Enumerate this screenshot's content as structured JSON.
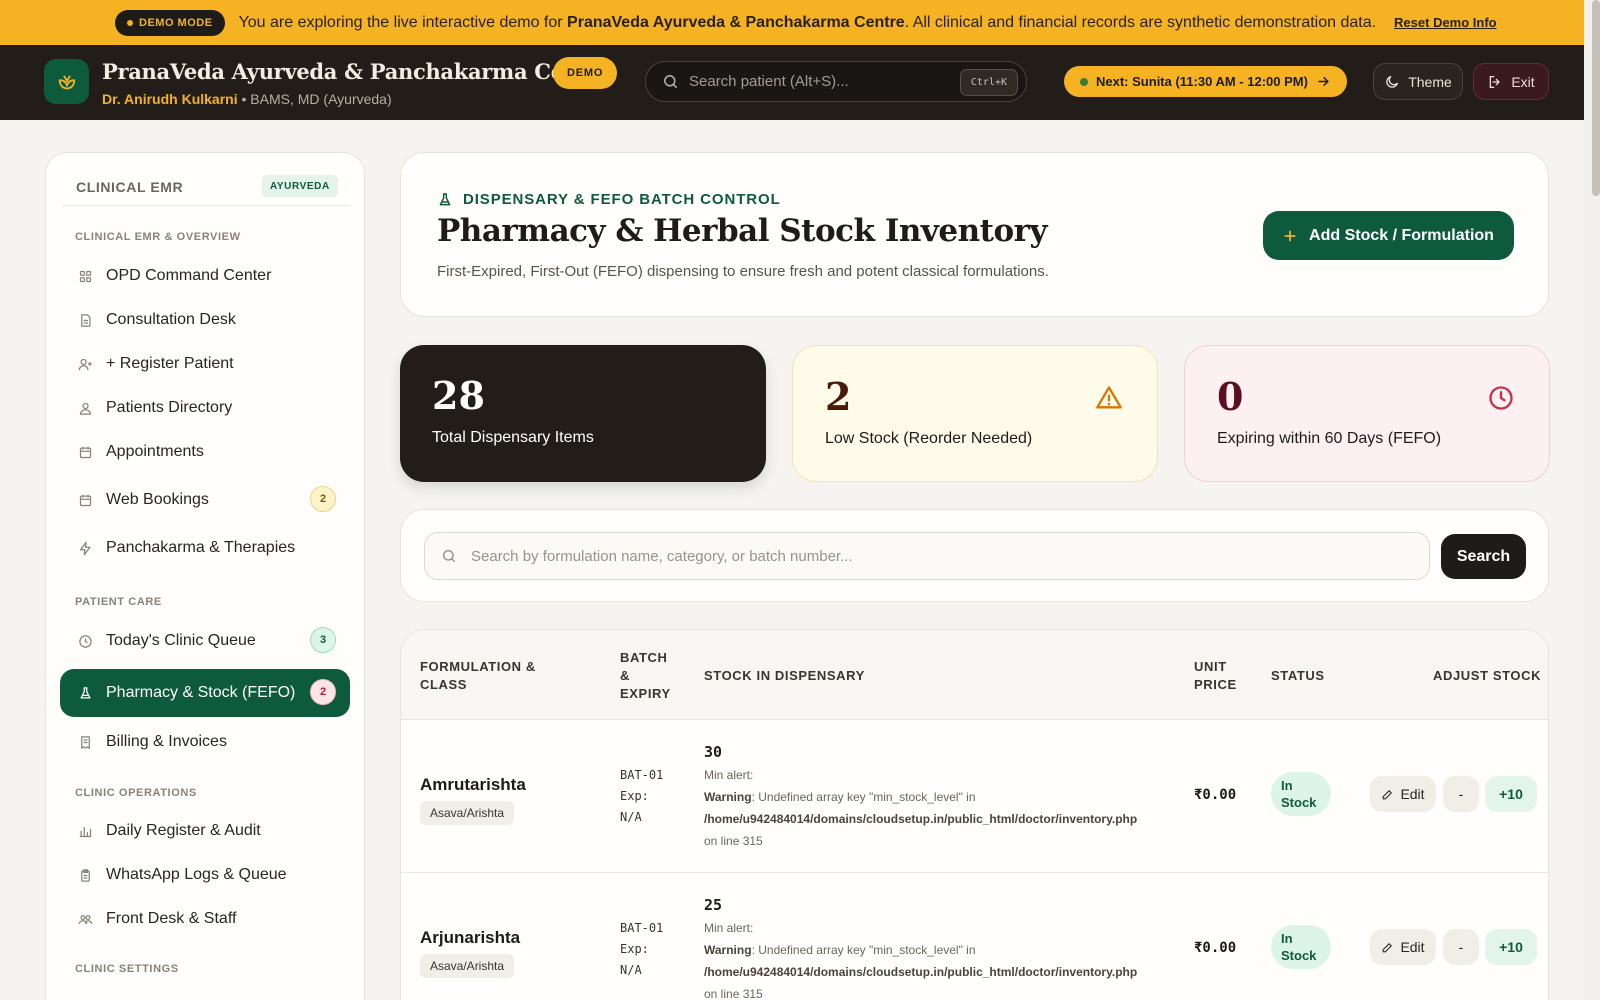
{
  "demo_bar": {
    "badge": "DEMO MODE",
    "text_prefix": "You are exploring the live interactive demo for ",
    "clinic_name": "PranaVeda Ayurveda & Panchakarma Centre",
    "text_suffix": ". All clinical and financial records are synthetic demonstration data.",
    "reset_link": "Reset Demo Info"
  },
  "header": {
    "brand_title": "PranaVeda Ayurveda & Panchakarma Centre",
    "demo_badge": "DEMO",
    "doctor": "Dr. Anirudh Kulkarni",
    "separator": " • ",
    "qualification": "BAMS, MD (Ayurveda)",
    "search_placeholder": "Search patient (Alt+S)...",
    "shortcut": "Ctrl+K",
    "next_label": "Next:",
    "next_value": "Sunita (11:30 AM - 12:00 PM)",
    "theme_label": "Theme",
    "exit_label": "Exit"
  },
  "sidebar": {
    "heading": "CLINICAL EMR",
    "badge": "AYURVEDA",
    "sections": {
      "overview": "CLINICAL EMR & OVERVIEW",
      "patient_care": "PATIENT CARE",
      "operations": "CLINIC OPERATIONS",
      "settings": "CLINIC SETTINGS"
    },
    "items": [
      {
        "label": "OPD Command Center",
        "icon": "grid-icon"
      },
      {
        "label": "Consultation Desk",
        "icon": "document-icon"
      },
      {
        "label": "+ Register Patient",
        "icon": "user-plus-icon"
      },
      {
        "label": "Patients Directory",
        "icon": "users-icon"
      },
      {
        "label": "Appointments",
        "icon": "calendar-icon"
      },
      {
        "label": "Web Bookings",
        "icon": "calendar-icon",
        "count": "2"
      },
      {
        "label": "Panchakarma & Therapies",
        "icon": "bolt-icon"
      },
      {
        "label": "Today's Clinic Queue",
        "icon": "clock-icon",
        "count": "3"
      },
      {
        "label": "Pharmacy & Stock (FEFO)",
        "icon": "flask-icon",
        "count": "2",
        "active": true
      },
      {
        "label": "Billing & Invoices",
        "icon": "receipt-icon"
      },
      {
        "label": "Daily Register & Audit",
        "icon": "bar-chart-icon"
      },
      {
        "label": "WhatsApp Logs & Queue",
        "icon": "clipboard-icon"
      },
      {
        "label": "Front Desk & Staff",
        "icon": "team-icon"
      }
    ]
  },
  "page": {
    "eyebrow": "DISPENSARY & FEFO BATCH CONTROL",
    "title": "Pharmacy & Herbal Stock Inventory",
    "description": "First-Expired, First-Out (FEFO) dispensing to ensure fresh and potent classical formulations.",
    "add_button": "Add Stock / Formulation"
  },
  "stats": [
    {
      "value": "28",
      "label": "Total Dispensary Items"
    },
    {
      "value": "2",
      "label": "Low Stock (Reorder Needed)",
      "icon": "warning-icon"
    },
    {
      "value": "0",
      "label": "Expiring within 60 Days (FEFO)",
      "icon": "clock-icon"
    }
  ],
  "table_search": {
    "placeholder": "Search by formulation name, category, or batch number...",
    "button": "Search"
  },
  "table": {
    "headers": {
      "formulation_l1": "FORMULATION &",
      "formulation_l2": "CLASS",
      "batch_l1": "BATCH",
      "batch_l2": "&",
      "batch_l3": "EXPIRY",
      "stock": "STOCK IN DISPENSARY",
      "price_l1": "UNIT",
      "price_l2": "PRICE",
      "status": "STATUS",
      "adjust": "ADJUST STOCK"
    },
    "rows": [
      {
        "name": "Amrutarishta",
        "category": "Asava/Arishta",
        "batch": "BAT-01",
        "exp_label": "Exp:",
        "exp_value": "N/A",
        "qty": "30",
        "min_alert": "Min alert:",
        "warning_label": "Warning",
        "warning_text": ": Undefined array key \"min_stock_level\" in",
        "warning_path": "/home/u942484014/domains/cloudsetup.in/public_html/doctor/inventory.php",
        "warning_line": "on line 315",
        "price": "₹0.00",
        "status_l1": "In",
        "status_l2": "Stock",
        "edit": "Edit",
        "minus": "-",
        "plus": "+10"
      },
      {
        "name": "Arjunarishta",
        "category": "Asava/Arishta",
        "batch": "BAT-01",
        "exp_label": "Exp:",
        "exp_value": "N/A",
        "qty": "25",
        "min_alert": "Min alert:",
        "warning_label": "Warning",
        "warning_text": ": Undefined array key \"min_stock_level\" in",
        "warning_path": "/home/u942484014/domains/cloudsetup.in/public_html/doctor/inventory.php",
        "warning_line": "on line 315",
        "price": "₹0.00",
        "status_l1": "In",
        "status_l2": "Stock",
        "edit": "Edit",
        "minus": "-",
        "plus": "+10"
      }
    ]
  },
  "colors": {
    "brand_green": "#0e5a3c",
    "accent_amber": "#f5b324",
    "header_dark": "#221d19"
  }
}
